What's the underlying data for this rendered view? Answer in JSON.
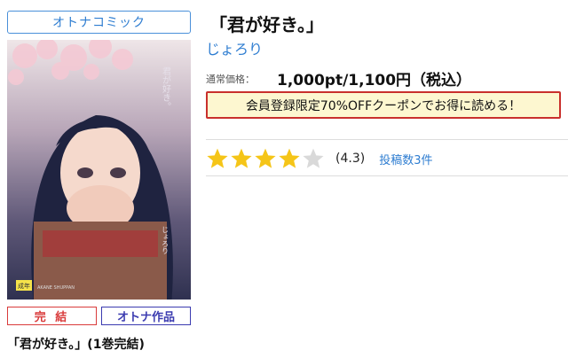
{
  "category": {
    "label": "オトナコミック"
  },
  "cover": {
    "title_vertical": "君が好き。",
    "author_vertical": "じょろり",
    "corner_tag": "成年",
    "fineprint": "AKANE SHUPPAN"
  },
  "badges": {
    "complete": "完 結",
    "adult": "オトナ作品"
  },
  "volume_title": "「君が好き。」(1巻完結)",
  "product": {
    "title": "「君が好き。」",
    "author": "じょろり",
    "price_label": "通常価格：",
    "price": "1,000pt/1,100円（税込）",
    "coupon": "会員登録限定70%OFFクーポンでお得に読める！"
  },
  "rating": {
    "score": 4.3,
    "max": 5,
    "score_text": "(4.3)",
    "reviews_text": "投稿数3件",
    "star_color": "#f5c518",
    "star_empty_color": "#d9d9d9"
  }
}
